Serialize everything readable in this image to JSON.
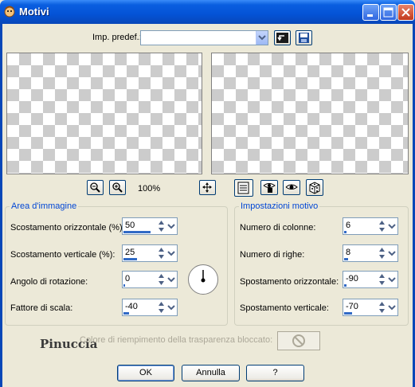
{
  "window": {
    "title": "Motivi"
  },
  "presets": {
    "label": "Imp. predef.:",
    "value": ""
  },
  "zoom": {
    "level": "100%"
  },
  "area_immagine": {
    "title": "Area d'immagine",
    "fields": [
      {
        "label": "Scostamento orizzontale (%):",
        "value": "50",
        "fill": 0.5
      },
      {
        "label": "Scostamento verticale (%):",
        "value": "25",
        "fill": 0.25
      },
      {
        "label": "Angolo di rotazione:",
        "value": "0",
        "fill": 0
      },
      {
        "label": "Fattore di scala:",
        "value": "-40",
        "fill": 0.1
      }
    ]
  },
  "impostazioni_motivo": {
    "title": "Impostazioni motivo",
    "fields": [
      {
        "label": "Numero di colonne:",
        "value": "6",
        "fill": 0.05
      },
      {
        "label": "Numero di righe:",
        "value": "8",
        "fill": 0.07
      },
      {
        "label": "Spostamento orizzontale:",
        "value": "-90",
        "fill": 0.05
      },
      {
        "label": "Spostamento verticale:",
        "value": "-70",
        "fill": 0.15
      }
    ]
  },
  "fill_color": {
    "label": "Colore di riempimento della trasparenza bloccato:"
  },
  "watermark": "Pinuccia",
  "buttons": {
    "ok": "OK",
    "cancel": "Annulla",
    "help": "?"
  },
  "icons": {
    "title": "app-icon",
    "minimize": "minimize-icon",
    "maximize": "maximize-icon",
    "close": "close-icon",
    "reset": "reset-icon",
    "save": "save-icon",
    "zoom_out": "zoom-out-icon",
    "zoom_in": "zoom-in-icon",
    "pan": "pan-icon",
    "proof": "proof-icon",
    "auto_proof": "auto-proof-icon",
    "reset_default": "reset-default-icon",
    "random": "dice-icon"
  },
  "colors": {
    "title_bar": "#0453D6",
    "legend": "#0046D5",
    "accent": "#316AC5",
    "checker": "#CCCCCC"
  }
}
